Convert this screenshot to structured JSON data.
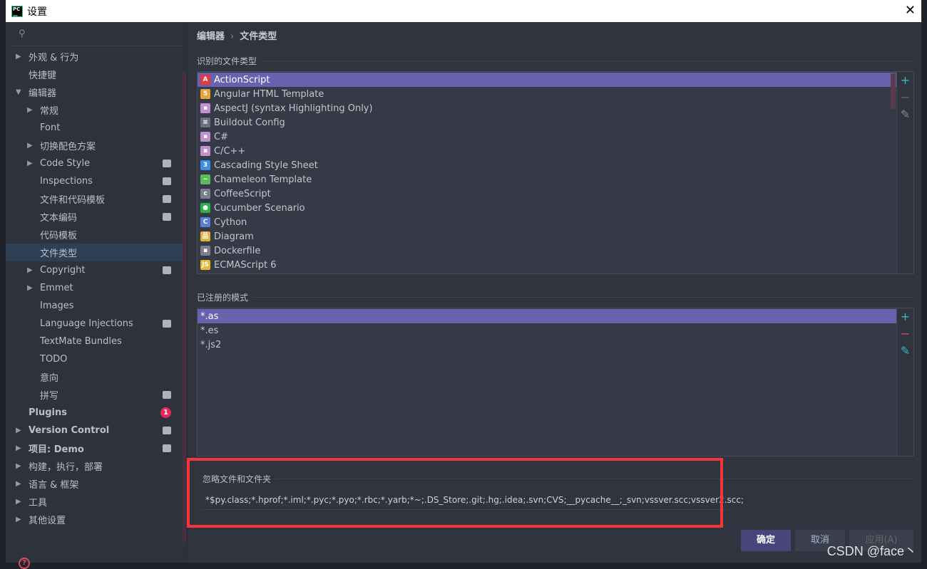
{
  "window": {
    "title": "设置",
    "logo": "PC",
    "close": "✕"
  },
  "sidebar": {
    "search_icon": "search-icon",
    "items": [
      {
        "label": "外观 & 行为",
        "arrow": "▶",
        "level": 0,
        "bold": false
      },
      {
        "label": "快捷键",
        "arrow": "",
        "level": 0
      },
      {
        "label": "编辑器",
        "arrow": "▼",
        "level": 0
      },
      {
        "label": "常规",
        "arrow": "▶",
        "level": 1
      },
      {
        "label": "Font",
        "arrow": "",
        "level": 1
      },
      {
        "label": "切换配色方案",
        "arrow": "▶",
        "level": 1
      },
      {
        "label": "Code Style",
        "arrow": "▶",
        "level": 1,
        "badge": true
      },
      {
        "label": "Inspections",
        "arrow": "",
        "level": 1,
        "badge": true
      },
      {
        "label": "文件和代码模板",
        "arrow": "",
        "level": 1,
        "badge": true
      },
      {
        "label": "文本编码",
        "arrow": "",
        "level": 1,
        "badge": true
      },
      {
        "label": "代码模板",
        "arrow": "",
        "level": 1
      },
      {
        "label": "文件类型",
        "arrow": "",
        "level": 1,
        "selected": true
      },
      {
        "label": "Copyright",
        "arrow": "▶",
        "level": 1,
        "badge": true
      },
      {
        "label": "Emmet",
        "arrow": "▶",
        "level": 1
      },
      {
        "label": "Images",
        "arrow": "",
        "level": 1
      },
      {
        "label": "Language Injections",
        "arrow": "",
        "level": 1,
        "badge": true
      },
      {
        "label": "TextMate Bundles",
        "arrow": "",
        "level": 1
      },
      {
        "label": "TODO",
        "arrow": "",
        "level": 1
      },
      {
        "label": "意向",
        "arrow": "",
        "level": 1
      },
      {
        "label": "拼写",
        "arrow": "",
        "level": 1,
        "badge": true
      },
      {
        "label": "Plugins",
        "arrow": "",
        "level": 0,
        "bold": true,
        "count": "1"
      },
      {
        "label": "Version Control",
        "arrow": "▶",
        "level": 0,
        "bold": true,
        "badge": true
      },
      {
        "label": "项目: Demo",
        "arrow": "▶",
        "level": 0,
        "bold": true,
        "badge": true
      },
      {
        "label": "构建，执行，部署",
        "arrow": "▶",
        "level": 0
      },
      {
        "label": "语言 & 框架",
        "arrow": "▶",
        "level": 0
      },
      {
        "label": "工具",
        "arrow": "▶",
        "level": 0
      },
      {
        "label": "其他设置",
        "arrow": "▶",
        "level": 0
      }
    ],
    "help": "?"
  },
  "breadcrumb": {
    "parent": "编辑器",
    "sep": "›",
    "current": "文件类型"
  },
  "file_types": {
    "title": "识别的文件类型",
    "items": [
      {
        "label": "ActionScript",
        "icon": "#e5383b",
        "glyph": "A",
        "selected": true
      },
      {
        "label": "Angular HTML Template",
        "icon": "#e8a33a",
        "glyph": "5"
      },
      {
        "label": "AspectJ (syntax Highlighting Only)",
        "icon": "#c58ed1",
        "glyph": "▪"
      },
      {
        "label": "Buildout Config",
        "icon": "#6b7080",
        "glyph": "≡"
      },
      {
        "label": "C#",
        "icon": "#c58ed1",
        "glyph": "▪"
      },
      {
        "label": "C/C++",
        "icon": "#c58ed1",
        "glyph": "▪"
      },
      {
        "label": "Cascading Style Sheet",
        "icon": "#3a8ee6",
        "glyph": "3"
      },
      {
        "label": "Chameleon Template",
        "icon": "#5bb85b",
        "glyph": "~"
      },
      {
        "label": "CoffeeScript",
        "icon": "#7a8090",
        "glyph": "c"
      },
      {
        "label": "Cucumber Scenario",
        "icon": "#27b24a",
        "glyph": "●"
      },
      {
        "label": "Cython",
        "icon": "#5a7fd6",
        "glyph": "C"
      },
      {
        "label": "Diagram",
        "icon": "#e0b23a",
        "glyph": "品"
      },
      {
        "label": "Dockerfile",
        "icon": "#7a8090",
        "glyph": "▪"
      },
      {
        "label": "ECMAScript 6",
        "icon": "#e8b630",
        "glyph": "JS"
      }
    ]
  },
  "patterns": {
    "title": "已注册的模式",
    "items": [
      {
        "label": "*.as",
        "selected": true
      },
      {
        "label": "*.es"
      },
      {
        "label": "*.js2"
      }
    ]
  },
  "ignore": {
    "title": "忽略文件和文件夹",
    "value": "*$py.class;*.hprof;*.iml;*.pyc;*.pyo;*.rbc;*.yarb;*~;.DS_Store;.git;.hg;.idea;.svn;CVS;__pycache__;_svn;vssver.scc;vssver2.scc;"
  },
  "buttons": {
    "ok": "确定",
    "cancel": "取消",
    "apply": "应用(A)"
  },
  "watermark": "CSDN @face丶",
  "colors": {
    "accent": "#6762ae",
    "highlight": "#f2363a",
    "add": "#3fb6c4",
    "remove": "#e0505a"
  }
}
